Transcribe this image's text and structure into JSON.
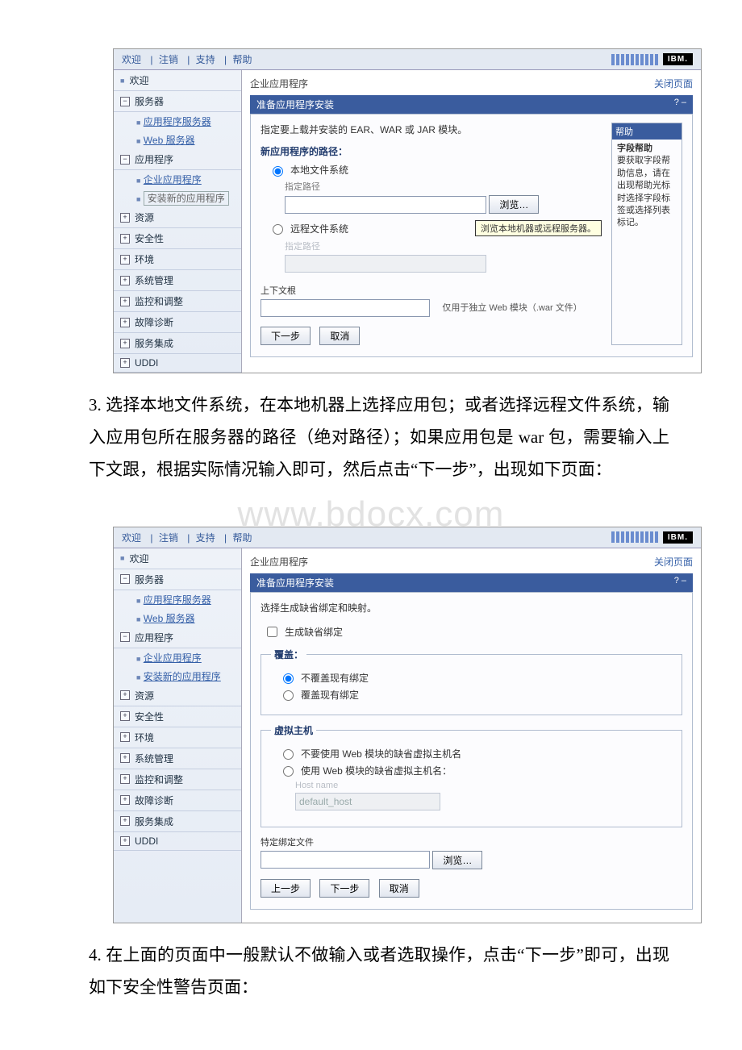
{
  "topbar": {
    "welcome": "欢迎",
    "logout": "注销",
    "support": "支持",
    "help": "帮助",
    "ibm": "IBM."
  },
  "sidebar": {
    "welcome": "欢迎",
    "groups": {
      "servers": "服务器",
      "apps": "应用程序",
      "resources": "资源",
      "security": "安全性",
      "env": "环境",
      "sysmgmt": "系统管理",
      "monitor": "监控和调整",
      "diag": "故障诊断",
      "svcint": "服务集成",
      "uddi": "UDDI"
    },
    "items": {
      "app_server": "应用程序服务器",
      "web_server": "Web 服务器",
      "ent_app": "企业应用程序",
      "install_new_boxed": "安装新的应用程序",
      "install_new": "安装新的应用程序"
    }
  },
  "main": {
    "page_title": "企业应用程序",
    "close_page": "关闭页面",
    "panel_title": "准备应用程序安装",
    "panel_ctrl": "?  –"
  },
  "s1": {
    "intro": "指定要上载并安装的 EAR、WAR 或 JAR 模块。",
    "path_heading": "新应用程序的路径：",
    "local_fs": "本地文件系统",
    "remote_fs": "远程文件系统",
    "spec_path": "指定路径",
    "spec_path_disabled": "指定路径",
    "browse": "浏览…",
    "tooltip": "浏览本地机器或远程服务器。",
    "context_root": "上下文根",
    "context_hint": "仅用于独立 Web 模块（.war 文件）",
    "next": "下一步",
    "cancel": "取消",
    "help": {
      "title": "帮助",
      "heading": "字段帮助",
      "body": "要获取字段帮助信息，请在出现帮助光标时选择字段标签或选择列表标记。"
    }
  },
  "s2": {
    "intro": "选择生成缺省绑定和映射。",
    "gen_default": "生成缺省绑定",
    "override_legend": "覆盖：",
    "no_override": "不覆盖现有绑定",
    "override": "覆盖现有绑定",
    "vhost_legend": "虚拟主机",
    "vhost_opt1": "不要使用 Web 模块的缺省虚拟主机名",
    "vhost_opt2": "使用 Web 模块的缺省虚拟主机名：",
    "hostname_label": "Host name",
    "hostname_value": "default_host",
    "bind_file": "特定绑定文件",
    "browse": "浏览…",
    "prev": "上一步",
    "next": "下一步",
    "cancel": "取消"
  },
  "para1": "3. 选择本地文件系统，在本地机器上选择应用包；或者选择远程文件系统，输入应用包所在服务器的路径（绝对路径）；如果应用包是 war 包，需要输入上下文跟，根据实际情况输入即可，然后点击“下一步”，出现如下页面：",
  "para2": "4. 在上面的页面中一般默认不做输入或者选取操作，点击“下一步”即可，出现如下安全性警告页面：",
  "watermark": "www.bdocx.com"
}
